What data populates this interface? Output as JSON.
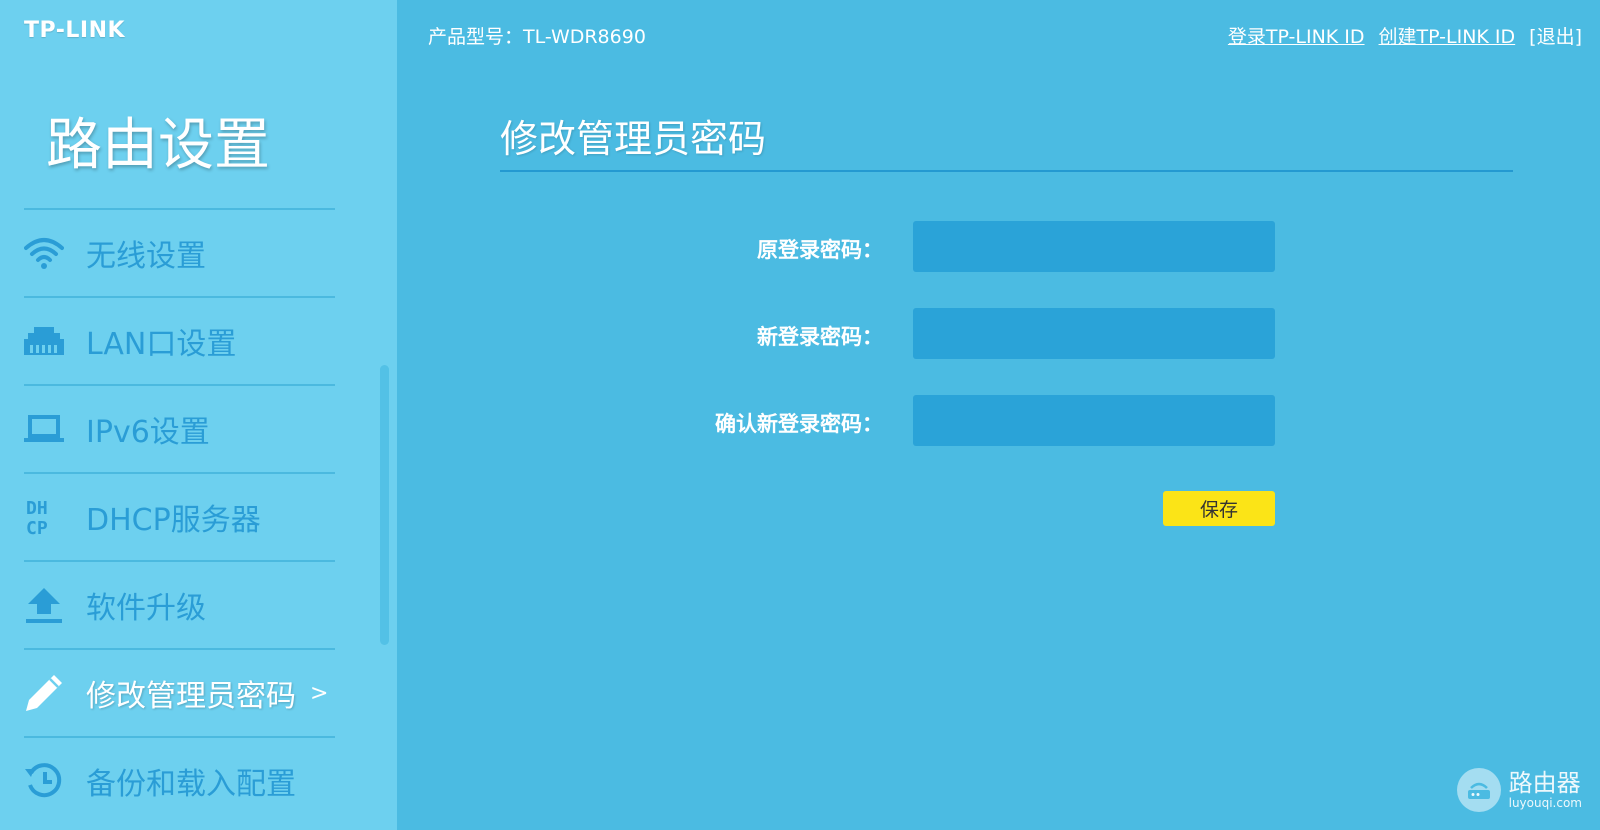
{
  "brand": {
    "logo_text": "TP-LINK"
  },
  "sidebar": {
    "title": "路由设置",
    "items": [
      {
        "label": "无线设置",
        "icon": "wifi-icon",
        "active": false
      },
      {
        "label": "LAN口设置",
        "icon": "lan-port-icon",
        "active": false
      },
      {
        "label": "IPv6设置",
        "icon": "laptop-icon",
        "active": false
      },
      {
        "label": "DHCP服务器",
        "icon": "dhcp-icon",
        "active": false
      },
      {
        "label": "软件升级",
        "icon": "upload-icon",
        "active": false
      },
      {
        "label": "修改管理员密码",
        "icon": "pencil-icon",
        "active": true,
        "arrow": ">"
      },
      {
        "label": "备份和载入配置",
        "icon": "history-icon",
        "active": false
      }
    ]
  },
  "topbar": {
    "model": "产品型号：TL-WDR8690",
    "login_link": "登录TP-LINK ID",
    "create_link": "创建TP-LINK ID",
    "logout": "[退出]"
  },
  "main": {
    "title": "修改管理员密码",
    "fields": [
      {
        "label": "原登录密码：",
        "value": "",
        "placeholder": ""
      },
      {
        "label": "新登录密码：",
        "value": "",
        "placeholder": ""
      },
      {
        "label": "确认新登录密码：",
        "value": "",
        "placeholder": ""
      }
    ],
    "save_label": "保存"
  },
  "watermark": {
    "name": "路由器",
    "domain": "luyouqi.com"
  },
  "colors": {
    "main_bg": "#4bbbe2",
    "sidebar_bg": "#6dd0ef",
    "menu_text": "#2a9dd6",
    "input_bg": "#2aa3d8",
    "save_button": "#fbe417"
  }
}
